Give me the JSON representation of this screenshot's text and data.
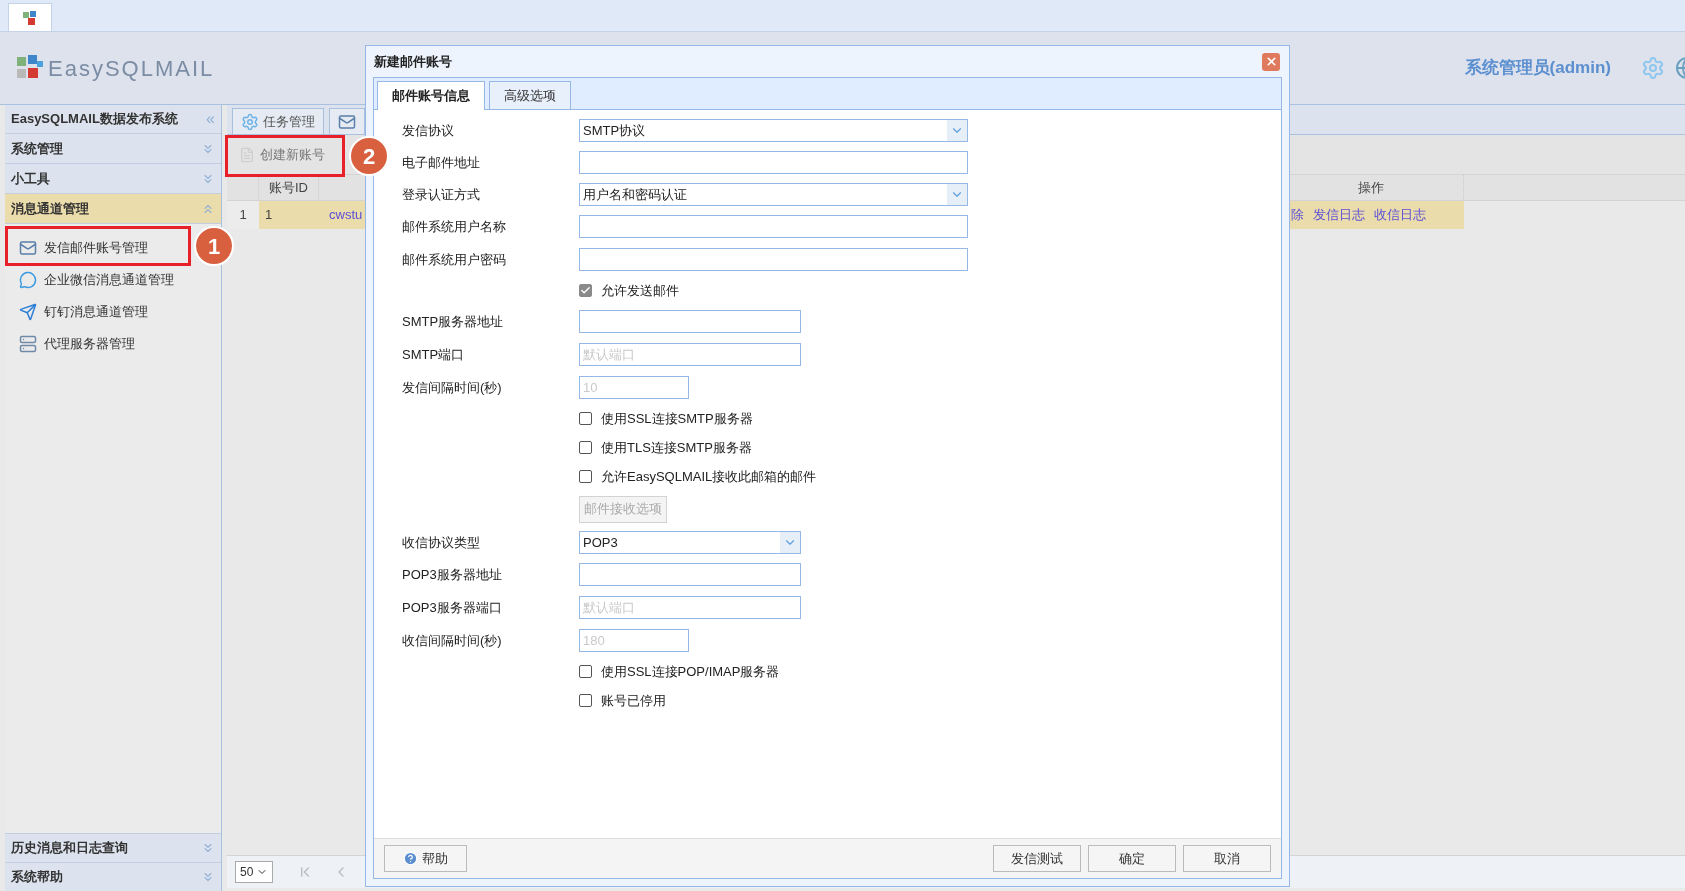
{
  "header": {
    "logo": "EasySQLMAIL",
    "user": "系统管理员(admin)"
  },
  "sidebar": {
    "title": "EasySQLMAIL数据发布系统",
    "collapse_glyph": "«",
    "sections": [
      {
        "label": "系统管理",
        "expanded": false
      },
      {
        "label": "小工具",
        "expanded": false
      },
      {
        "label": "消息通道管理",
        "expanded": true,
        "items": [
          {
            "label": "发信邮件账号管理"
          },
          {
            "label": "企业微信消息通道管理"
          },
          {
            "label": "钉钉消息通道管理"
          },
          {
            "label": "代理服务器管理"
          }
        ]
      }
    ],
    "bottom_sections": [
      {
        "label": "历史消息和日志查询",
        "expanded": false
      },
      {
        "label": "系统帮助",
        "expanded": false
      }
    ]
  },
  "main_tabs": [
    {
      "label": "任务管理"
    }
  ],
  "toolbar": {
    "create_button": "创建新账号"
  },
  "table": {
    "columns": [
      "账号ID",
      "操作"
    ],
    "rows": [
      {
        "row_number": "1",
        "id": "1",
        "column_3": "cwstu",
        "actions": [
          "除",
          "发信日志",
          "收信日志"
        ]
      }
    ]
  },
  "pager": {
    "page_size": "50"
  },
  "dialog": {
    "title": "新建邮件账号",
    "tabs": [
      {
        "label": "邮件账号信息",
        "selected": true
      },
      {
        "label": "高级选项",
        "selected": false
      }
    ],
    "rows": [
      {
        "kind": "select",
        "label": "发信协议",
        "value": "SMTP协议"
      },
      {
        "kind": "input",
        "label": "电子邮件地址"
      },
      {
        "kind": "select",
        "label": "登录认证方式",
        "value": "用户名和密码认证"
      },
      {
        "kind": "input",
        "label": "邮件系统用户名称"
      },
      {
        "kind": "input",
        "label": "邮件系统用户密码"
      },
      {
        "kind": "checkbox",
        "label": "允许发送邮件",
        "checked": true
      },
      {
        "kind": "input",
        "label": "SMTP服务器地址"
      },
      {
        "kind": "input",
        "label": "SMTP端口",
        "placeholder": "默认端口"
      },
      {
        "kind": "input",
        "label": "发信间隔时间(秒)",
        "placeholder": "10"
      },
      {
        "kind": "checkbox",
        "label": "使用SSL连接SMTP服务器",
        "checked": false
      },
      {
        "kind": "checkbox",
        "label": "使用TLS连接SMTP服务器",
        "checked": false
      },
      {
        "kind": "checkbox",
        "label": "允许EasySQLMAIL接收此邮箱的邮件",
        "checked": false
      },
      {
        "kind": "button",
        "label": "邮件接收选项",
        "disabled": true
      },
      {
        "kind": "select",
        "label": "收信协议类型",
        "value": "POP3"
      },
      {
        "kind": "input",
        "label": "POP3服务器地址"
      },
      {
        "kind": "input",
        "label": "POP3服务器端口",
        "placeholder": "默认端口"
      },
      {
        "kind": "input",
        "label": "收信间隔时间(秒)",
        "placeholder": "180"
      },
      {
        "kind": "checkbox",
        "label": "使用SSL连接POP/IMAP服务器",
        "checked": false
      },
      {
        "kind": "checkbox",
        "label": "账号已停用",
        "checked": false
      }
    ],
    "help_button": "帮助",
    "buttons": [
      "发信测试",
      "确定",
      "取消"
    ]
  },
  "annotations": [
    {
      "label": "1"
    },
    {
      "label": "2"
    }
  ]
}
